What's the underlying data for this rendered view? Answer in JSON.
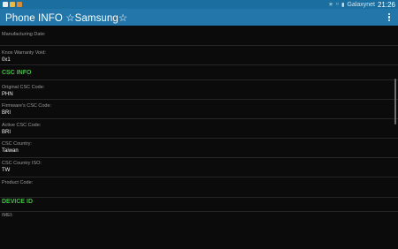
{
  "statusbar": {
    "carrier": "Galaxynet",
    "time": "21:26",
    "icons": [
      "notification-icon",
      "app-icon",
      "app-icon",
      "bluetooth-icon",
      "wifi-icon",
      "battery-icon"
    ]
  },
  "actionbar": {
    "title": "Phone INFO  ☆Samsung☆"
  },
  "rows": [
    {
      "label": "Manufacturing Date:",
      "value": ""
    },
    {
      "label": "Knox Warranty Void:",
      "value": "0x1"
    },
    {
      "label": "Original CSC Code:",
      "value": "PHN"
    },
    {
      "label": "Firmware's CSC Code:",
      "value": "BRI"
    },
    {
      "label": "Active CSC Code:",
      "value": "BRI"
    },
    {
      "label": "CSC Country:",
      "value": "Taiwan"
    },
    {
      "label": "CSC Country ISO:",
      "value": "TW"
    },
    {
      "label": "Product Code:",
      "value": ""
    },
    {
      "label": "IMEI:",
      "value": ""
    }
  ],
  "sections": {
    "csc_info": "CSC INFO",
    "device_id": "DEVICE ID"
  },
  "colors": {
    "statusbar": "#1a6fa0",
    "actionbar": "#2276aa",
    "section_header": "#3fbf3f",
    "background": "#0b0b0b"
  }
}
